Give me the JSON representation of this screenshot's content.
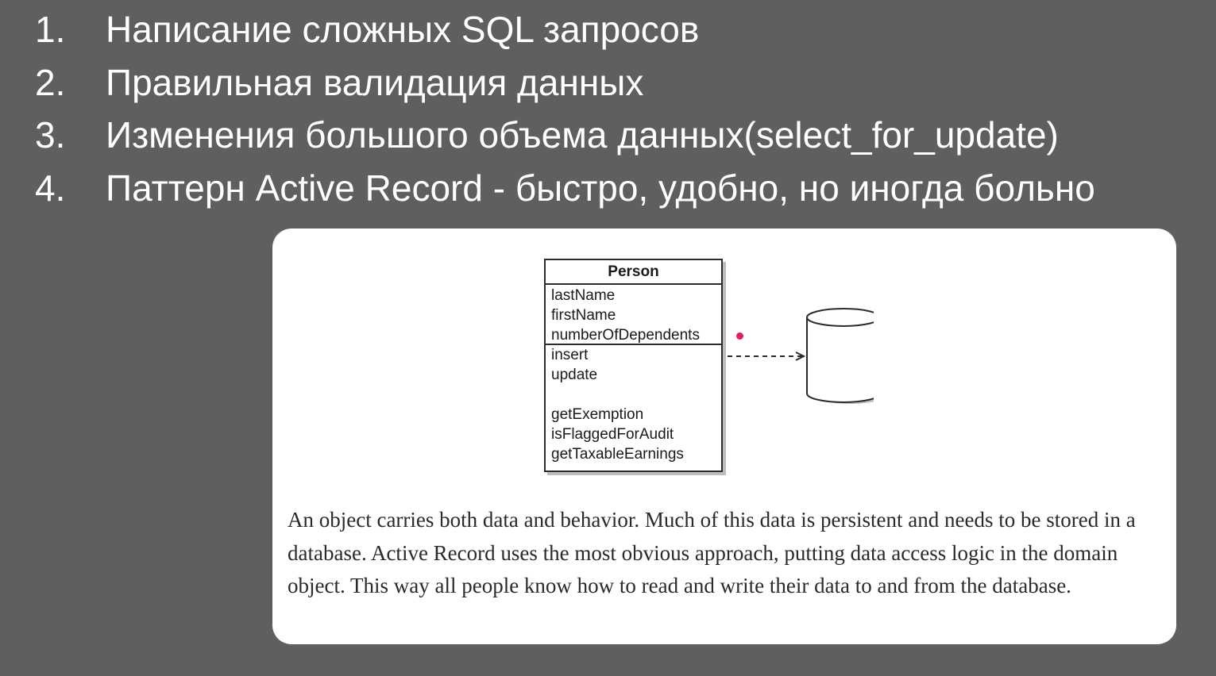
{
  "list": [
    {
      "number": "1.",
      "text": "Написание сложных SQL запросов"
    },
    {
      "number": "2.",
      "text": "Правильная валидация данных"
    },
    {
      "number": "3.",
      "text": "Изменения большого объема данных(select_for_update)"
    },
    {
      "number": "4.",
      "text": "Паттерн Active Record - быстро, удобно, но иногда больно"
    }
  ],
  "diagram": {
    "class_name": "Person",
    "attributes": [
      "lastName",
      "firstName",
      "numberOfDependents"
    ],
    "methods": [
      "insert",
      "update",
      "getExemption",
      "isFlaggedForAudit",
      "getTaxableEarnings"
    ]
  },
  "caption": "An object carries both data and behavior. Much of this data is persistent and needs to be stored in a database. Active Record uses the most obvious approach, putting data access logic in the domain object. This way all people know how to read and write their data to and from the database.",
  "colors": {
    "background": "#5f5e61",
    "text": "#ffffff",
    "card": "#ffffff",
    "dot": "#e0205a"
  }
}
